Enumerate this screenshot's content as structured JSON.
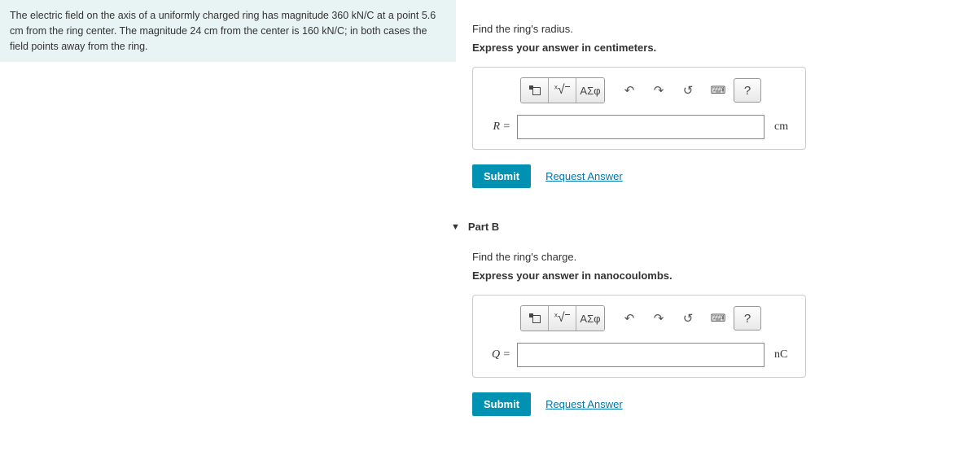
{
  "problem_text": "The electric field on the axis of a uniformly charged ring has magnitude 360 kN/C at a point 5.6 cm from the ring center. The magnitude 24 cm from the center is 160 kN/C; in both cases the field points away from the ring.",
  "partA": {
    "prompt": "Find the ring's radius.",
    "instruction": "Express your answer in centimeters.",
    "var": "R =",
    "unit": "cm",
    "value": "",
    "submit": "Submit",
    "request": "Request Answer"
  },
  "partB": {
    "header": "Part B",
    "prompt": "Find the ring's charge.",
    "instruction": "Express your answer in nanocoulombs.",
    "var": "Q =",
    "unit": "nC",
    "value": "",
    "submit": "Submit",
    "request": "Request Answer"
  },
  "toolbar": {
    "greek": "ΑΣφ",
    "help": "?"
  }
}
